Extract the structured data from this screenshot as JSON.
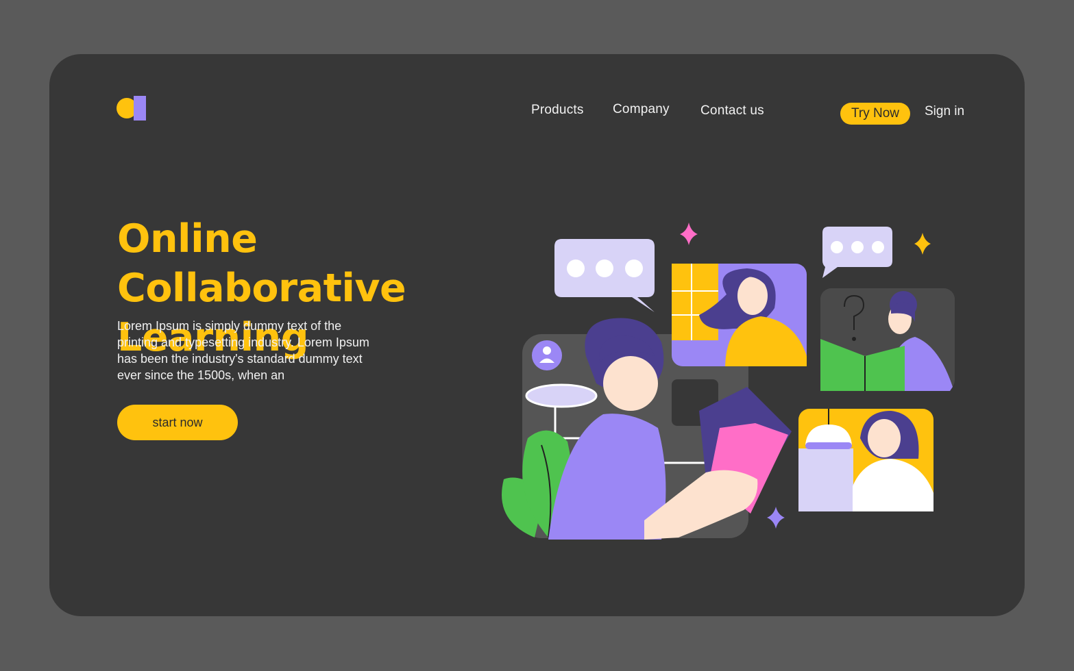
{
  "nav": {
    "items": [
      "Products",
      "Company",
      "Contact us"
    ],
    "try_now": "Try Now",
    "sign_in": "Sign in"
  },
  "hero": {
    "title_line1": "Online Collaborative",
    "title_line2": "Learning",
    "body": "Lorem Ipsum is simply dummy text of the printing and typesetting industry. Lorem Ipsum has been the industry's standard dummy text ever since the 1500s, when an",
    "cta": "start now"
  },
  "colors": {
    "page_bg": "#5a5a5a",
    "card_bg": "#373737",
    "accent_yellow": "#ffc20e",
    "accent_purple": "#9b87f5",
    "accent_pink": "#ff6ec7",
    "accent_green": "#4fc34f"
  },
  "icons": [
    "logo-mark",
    "chat-bubble-icon",
    "user-avatar-icon",
    "sparkle-icon",
    "question-mark-icon"
  ]
}
